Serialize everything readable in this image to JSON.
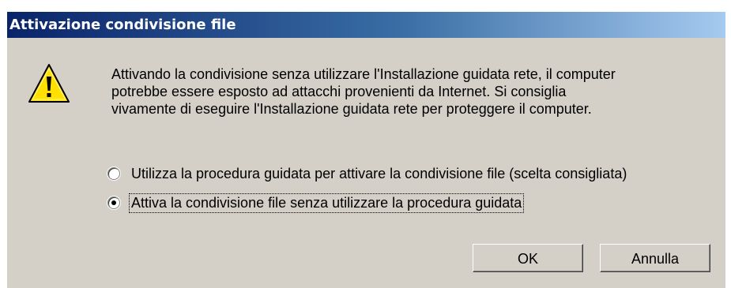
{
  "window": {
    "title": "Attivazione condivisione file"
  },
  "icons": {
    "warning": "warning-icon"
  },
  "message": {
    "lines": [
      "Attivando la condivisione senza utilizzare l'Installazione guidata rete, il computer",
      "potrebbe essere esposto ad attacchi provenienti da Internet. Si consiglia",
      "vivamente di eseguire l'Installazione guidata rete per proteggere il computer."
    ]
  },
  "options": [
    {
      "label": "Utilizza la procedura guidata per attivare la condivisione file (scelta consigliata)",
      "selected": false
    },
    {
      "label": "Attiva la condivisione file senza utilizzare la procedura guidata",
      "selected": true
    }
  ],
  "buttons": {
    "ok": "OK",
    "cancel": "Annulla"
  },
  "colors": {
    "titlebar_start": "#0a246a",
    "titlebar_end": "#a6caf0",
    "dialog_bg": "#d4d0c8",
    "warning_yellow": "#ffd800"
  }
}
